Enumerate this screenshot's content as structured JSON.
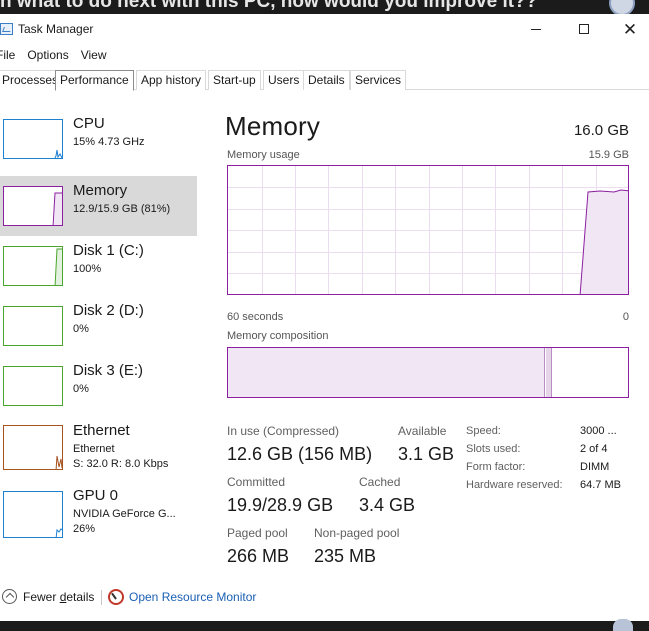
{
  "background": {
    "snippet": "n what to do next with this PC, how would you improve it??"
  },
  "window": {
    "title": "Task Manager"
  },
  "menu": [
    {
      "label": "File"
    },
    {
      "label": "Options"
    },
    {
      "label": "View"
    }
  ],
  "tabs": [
    {
      "label": "Processes",
      "active": false
    },
    {
      "label": "Performance",
      "active": true
    },
    {
      "label": "App history",
      "active": false
    },
    {
      "label": "Start-up",
      "active": false
    },
    {
      "label": "Users",
      "active": false
    },
    {
      "label": "Details",
      "active": false
    },
    {
      "label": "Services",
      "active": false
    }
  ],
  "sidebar": {
    "items": [
      {
        "name": "CPU",
        "line1": "15% 4.73 GHz",
        "line2": "",
        "color": "#1f7fd1",
        "selected": false
      },
      {
        "name": "Memory",
        "line1": "12.9/15.9 GB (81%)",
        "line2": "",
        "color": "#8b1fa0",
        "selected": true
      },
      {
        "name": "Disk 1 (C:)",
        "line1": "100%",
        "line2": "",
        "color": "#4aa52e",
        "selected": false
      },
      {
        "name": "Disk 2 (D:)",
        "line1": "0%",
        "line2": "",
        "color": "#4aa52e",
        "selected": false
      },
      {
        "name": "Disk 3 (E:)",
        "line1": "0%",
        "line2": "",
        "color": "#4aa52e",
        "selected": false
      },
      {
        "name": "Ethernet",
        "line1": "Ethernet",
        "line2": "S: 32.0  R: 8.0 Kbps",
        "color": "#a7531e",
        "selected": false
      },
      {
        "name": "GPU 0",
        "line1": "NVIDIA GeForce G...",
        "line2": "26%",
        "color": "#1f7fd1",
        "selected": false
      }
    ]
  },
  "main": {
    "title": "Memory",
    "total": "16.0 GB",
    "usage_label": "Memory usage",
    "usage_max": "15.9 GB",
    "time_left": "60 seconds",
    "time_right": "0",
    "composition_label": "Memory composition",
    "accent_color": "#8b1fa0",
    "stats": {
      "in_use_label": "In use (Compressed)",
      "in_use_value": "12.6 GB (156 MB)",
      "available_label": "Available",
      "available_value": "3.1 GB",
      "committed_label": "Committed",
      "committed_value": "19.9/28.9 GB",
      "cached_label": "Cached",
      "cached_value": "3.4 GB",
      "paged_label": "Paged pool",
      "paged_value": "266 MB",
      "nonpaged_label": "Non-paged pool",
      "nonpaged_value": "235 MB"
    },
    "specs": {
      "speed_label": "Speed:",
      "speed_value": "3000 ...",
      "slots_label": "Slots used:",
      "slots_value": "2 of 4",
      "form_label": "Form factor:",
      "form_value": "DIMM",
      "reserved_label": "Hardware reserved:",
      "reserved_value": "64.7 MB"
    }
  },
  "footer": {
    "fewer_details_pre": "Fewer ",
    "fewer_details_acc": "d",
    "fewer_details_post": "etails",
    "open_resource_monitor": "Open Resource Monitor"
  }
}
